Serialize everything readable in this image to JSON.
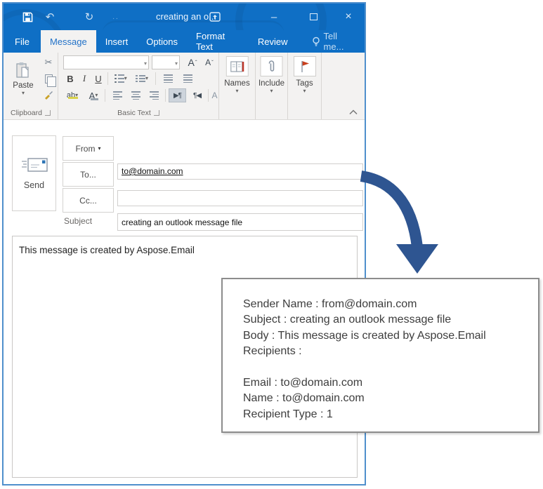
{
  "window": {
    "title": "creating an o...",
    "glyphs": {
      "undo": "↶",
      "redo": "↻",
      "dots": "..",
      "minimize": "–",
      "close": "×",
      "caret": "▾"
    }
  },
  "tabs": [
    {
      "label": "File",
      "selected": false
    },
    {
      "label": "Message",
      "selected": true
    },
    {
      "label": "Insert",
      "selected": false
    },
    {
      "label": "Options",
      "selected": false
    },
    {
      "label": "Format Text",
      "selected": false
    },
    {
      "label": "Review",
      "selected": false
    },
    {
      "label": "Tell me...",
      "selected": false
    }
  ],
  "ribbon": {
    "clipboard": {
      "paste_label": "Paste",
      "group_label": "Clipboard",
      "cut_glyph": "✂"
    },
    "basic_text": {
      "group_label": "Basic Text",
      "bold": "B",
      "italic": "I",
      "underline": "U",
      "grow_font": "A",
      "shrink_font": "A",
      "highlight": "ab",
      "font_color": "A",
      "ltr": "▶¶",
      "rtl": "¶◀",
      "clear_formatting": "A"
    },
    "names_label": "Names",
    "include_label": "Include",
    "tags_label": "Tags"
  },
  "compose": {
    "send_label": "Send",
    "from_label": "From",
    "to_label": "To...",
    "to_value": "to@domain.com",
    "cc_label": "Cc...",
    "cc_value": "",
    "subject_label": "Subject",
    "subject_value": "creating an outlook message file",
    "body_text": "This message is created by Aspose.Email"
  },
  "callout": {
    "lines": [
      "Sender Name : from@domain.com",
      "Subject : creating an outlook message file",
      "Body : This message is created by Aspose.Email",
      "Recipients :",
      "",
      "Email : to@domain.com",
      "Name : to@domain.com",
      "Recipient Type : 1"
    ]
  },
  "colors": {
    "titlebar_blue": "#0F6FC5",
    "window_border": "#4F8FCC",
    "selected_tab_text": "#2272C8",
    "arrow_blue": "#2E5591",
    "flag_red": "#C8401E",
    "callout_border": "#8C8C8C"
  }
}
